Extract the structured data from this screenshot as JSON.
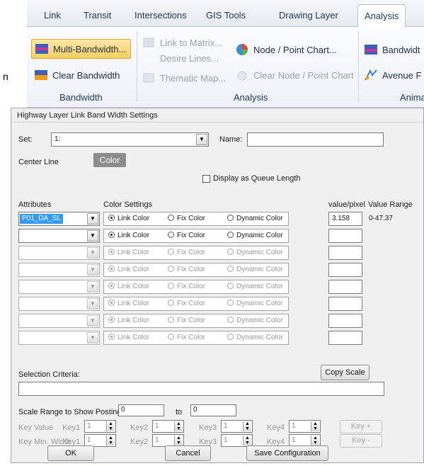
{
  "outside_mark": "n",
  "ribbon": {
    "tabs": [
      "Link",
      "Transit",
      "Intersections",
      "GIS Tools",
      "Drawing Layer",
      "Analysis"
    ],
    "active_tab": "Analysis",
    "buttons": {
      "multi_bandwidth": "Multi-Bandwidth...",
      "clear_bandwidth": "Clear Bandwidth",
      "link_to_matrix": "Link to Matrix...",
      "desire_lines": "Desire Lines...",
      "thematic_map": "Thematic Map...",
      "node_point_chart": "Node / Point Chart...",
      "clear_node_point_chart": "Clear Node / Point Chart",
      "bandwidth_cut": "Bandwidt",
      "avenue_cut": "Avenue F"
    },
    "groups": {
      "bandwidth": "Bandwidth",
      "analysis": "Analysis",
      "animation": "Anima"
    }
  },
  "dialog": {
    "title": "Highway Layer Link Band Width Settings",
    "set_label": "Set:",
    "set_value": "1:",
    "name_label": "Name:",
    "name_value": "",
    "center_line_label": "Center Line",
    "color_button": "Color",
    "queue_checkbox_label": "Display as Queue Length",
    "queue_checked": false,
    "headers": {
      "attributes": "Attributes",
      "color_settings": "Color Settings",
      "value_pixel": "value/pixel",
      "value_range": "Value Range"
    },
    "radio_labels": [
      "Link Color",
      "Fix Color",
      "Dynamic Color"
    ],
    "rows": [
      {
        "attribute": "P01_DA_SL",
        "value_pixel": "3.158",
        "value_range": "0-47.37",
        "enabled": true
      },
      {
        "attribute": "",
        "value_pixel": "",
        "value_range": "",
        "enabled": true
      },
      {
        "attribute": "",
        "value_pixel": "",
        "value_range": "",
        "enabled": false
      },
      {
        "attribute": "",
        "value_pixel": "",
        "value_range": "",
        "enabled": false
      },
      {
        "attribute": "",
        "value_pixel": "",
        "value_range": "",
        "enabled": false
      },
      {
        "attribute": "",
        "value_pixel": "",
        "value_range": "",
        "enabled": false
      },
      {
        "attribute": "",
        "value_pixel": "",
        "value_range": "",
        "enabled": false
      },
      {
        "attribute": "",
        "value_pixel": "",
        "value_range": "",
        "enabled": false
      }
    ],
    "selection_criteria_label": "Selection Criteria:",
    "selection_criteria_value": "",
    "copy_scale_button": "Copy Scale",
    "scale_range_label": "Scale Range to Show Posting",
    "scale_from": "0",
    "scale_to_label": "to",
    "scale_to": "0",
    "key_value_label": "Key Value",
    "key_min_width_label": "Key Min. Width",
    "key_labels": [
      "Key1",
      "Key2",
      "Key3",
      "Key4"
    ],
    "key_values": [
      "1",
      "1",
      "1",
      "1"
    ],
    "key_min_widths": [
      "1",
      "1",
      "1",
      "1"
    ],
    "key_plus_button": "Key +",
    "key_minus_button": "Key -",
    "ok_button": "OK",
    "cancel_button": "Cancel",
    "save_config_button": "Save Configuration"
  }
}
